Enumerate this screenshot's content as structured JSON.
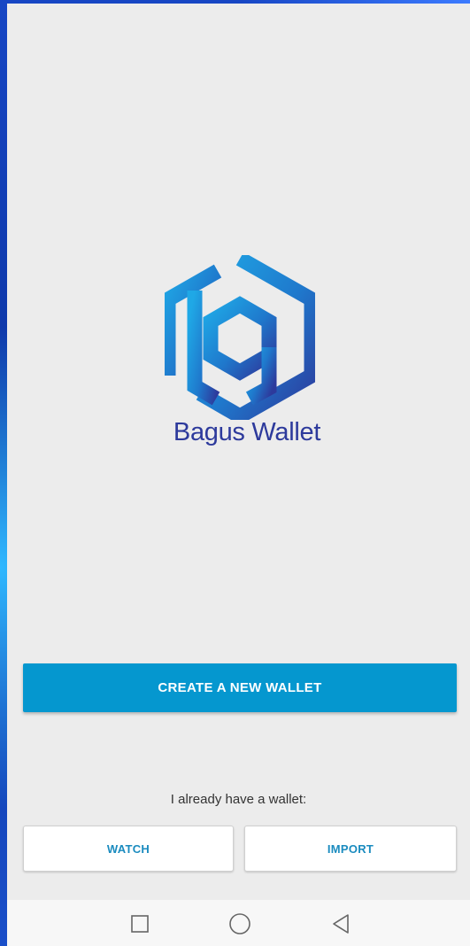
{
  "app": {
    "name": "Bagus Wallet"
  },
  "actions": {
    "create_label": "CREATE A NEW WALLET",
    "have_wallet_text": "I already have a wallet:",
    "watch_label": "WATCH",
    "import_label": "IMPORT"
  },
  "colors": {
    "primary": "#0597cf",
    "logo_blue_light": "#1fa2e0",
    "logo_blue_dark": "#2d3a9c",
    "background": "#ececec"
  },
  "navigation": {
    "icons": [
      "recent-apps-icon",
      "home-icon",
      "back-icon"
    ]
  }
}
